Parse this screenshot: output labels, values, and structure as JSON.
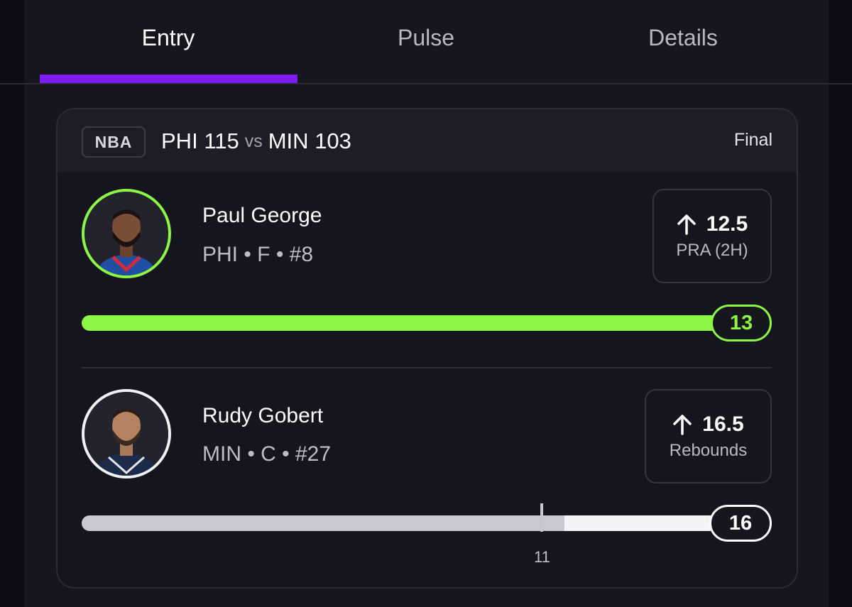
{
  "tabs": [
    {
      "label": "Entry",
      "active": true
    },
    {
      "label": "Pulse",
      "active": false
    },
    {
      "label": "Details",
      "active": false
    }
  ],
  "colors": {
    "accent": "#7c1cf2",
    "success": "#8cf545",
    "neutral": "#c9c9cf"
  },
  "game": {
    "league": "NBA",
    "home_team": "PHI",
    "home_score": "115",
    "vs": "vs",
    "away_team": "MIN",
    "away_score": "103",
    "status": "Final"
  },
  "players": [
    {
      "name": "Paul George",
      "meta": "PHI • F • #8",
      "direction_icon": "arrow-up-icon",
      "line": "12.5",
      "stat": "PRA (2H)",
      "result": "13",
      "progress_fraction": 1.0
    },
    {
      "name": "Rudy Gobert",
      "meta": "MIN • C • #27",
      "direction_icon": "arrow-up-icon",
      "line": "16.5",
      "stat": "Rebounds",
      "result": "16",
      "progress_fraction": 1.0,
      "marker_value": "11"
    }
  ]
}
